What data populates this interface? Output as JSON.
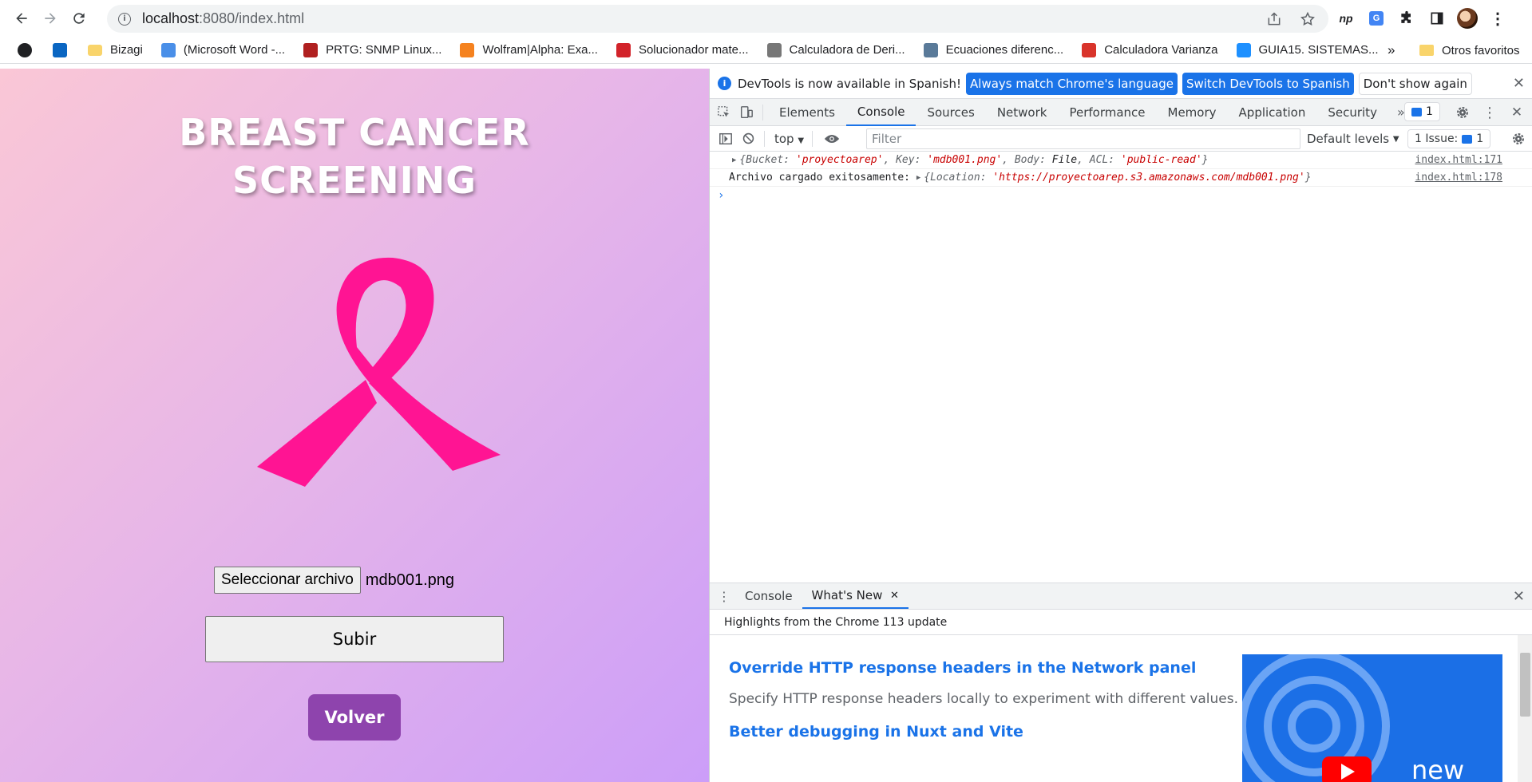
{
  "browser": {
    "url_host": "localhost",
    "url_rest": ":8080/index.html",
    "bookmarks": [
      {
        "label": "",
        "icon": "globe-icon",
        "color": "#202124"
      },
      {
        "label": "",
        "icon": "linkedin-icon",
        "color": "#0a66c2"
      },
      {
        "label": "Bizagi",
        "icon": "folder-icon",
        "color": "#f9d46b"
      },
      {
        "label": "(Microsoft Word -...",
        "icon": "word-icon",
        "color": "#4a8fe8"
      },
      {
        "label": "PRTG: SNMP Linux...",
        "icon": "prtg-icon",
        "color": "#b02020"
      },
      {
        "label": "Wolfram|Alpha: Exa...",
        "icon": "wolfram-icon",
        "color": "#f5821f"
      },
      {
        "label": "Solucionador mate...",
        "icon": "symbolab-icon",
        "color": "#d2232a"
      },
      {
        "label": "Calculadora de Deri...",
        "icon": "derivative-icon",
        "color": "#777777"
      },
      {
        "label": "Ecuaciones diferenc...",
        "icon": "triangle-icon",
        "color": "#5a7a99"
      },
      {
        "label": "Calculadora Varianza",
        "icon": "varianza-icon",
        "color": "#d9342b"
      },
      {
        "label": "GUIA15. SISTEMAS...",
        "icon": "wn-icon",
        "color": "#1e90ff"
      }
    ],
    "more_label": "»",
    "other_bookmarks": "Otros favoritos"
  },
  "page": {
    "title_line1": "BREAST CANCER",
    "title_line2": "SCREENING",
    "file_button": "Seleccionar archivo",
    "file_name": "mdb001.png",
    "upload_button": "Subir",
    "back_button": "Volver"
  },
  "devtools": {
    "infobar_text": "DevTools is now available in Spanish!",
    "infobar_btn1": "Always match Chrome's language",
    "infobar_btn2": "Switch DevTools to Spanish",
    "infobar_btn3": "Don't show again",
    "tabs": [
      "Elements",
      "Console",
      "Sources",
      "Network",
      "Performance",
      "Memory",
      "Application",
      "Security"
    ],
    "active_tab": "Console",
    "issues_badge": "1",
    "context": "top",
    "filter_placeholder": "Filter",
    "levels": "Default levels",
    "issue_count": "1 Issue:",
    "issue_count_n": "1",
    "log1": {
      "text_open": "{",
      "k1": "Bucket",
      "v1": "'proyectoarep'",
      "k2": "Key",
      "v2": "'mdb001.png'",
      "k3": "Body",
      "v3": "File",
      "k4": "ACL",
      "v4": "'public-read'",
      "text_close": "}",
      "src": "index.html:171"
    },
    "log2": {
      "prefix": "Archivo cargado exitosamente:",
      "k1": "Location",
      "v1": "'https://proyectoarep.s3.amazonaws.com/mdb001.png'",
      "src": "index.html:178"
    },
    "drawer_tab1": "Console",
    "drawer_tab2": "What's New",
    "whatsnew_header": "Highlights from the Chrome 113 update",
    "whatsnew_h1": "Override HTTP response headers in the Network panel",
    "whatsnew_p": "Specify HTTP response headers locally to experiment with different values.",
    "whatsnew_h2": "Better debugging in Nuxt and Vite",
    "whatsnew_img_text": "new"
  },
  "colors": {
    "ribbon": "#ff1493",
    "back_button": "#8e44ad",
    "accent": "#1a73e8"
  }
}
